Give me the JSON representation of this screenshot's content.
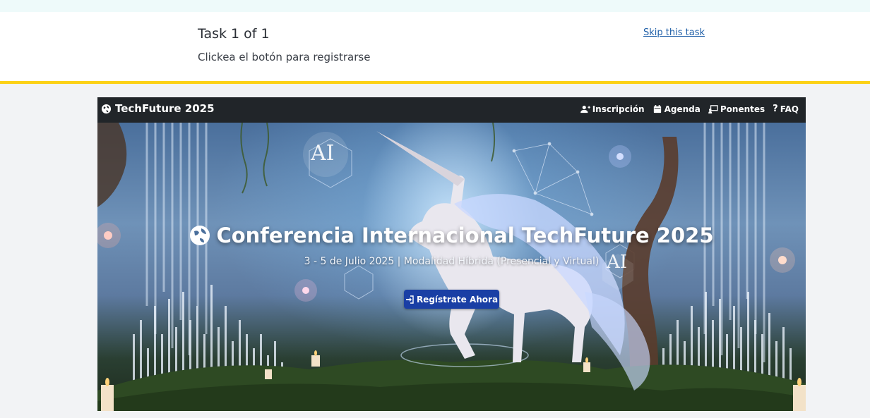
{
  "task": {
    "title": "Task 1 of 1",
    "instruction": "Clickea el botón para registrarse",
    "skip_label": "Skip this task"
  },
  "site": {
    "brand": "TechFuture 2025",
    "nav": [
      {
        "label": "Inscripción",
        "icon": "user-plus-icon"
      },
      {
        "label": "Agenda",
        "icon": "calendar-icon"
      },
      {
        "label": "Ponentes",
        "icon": "presenter-icon"
      },
      {
        "label": "FAQ",
        "icon": "question-icon"
      }
    ],
    "hero": {
      "title": "Conferencia Internacional TechFuture 2025",
      "subtitle": "3 - 5 de Julio 2025 | Modalidad Híbrida (Presencial y Virtual)",
      "cta_label": "Regístrate Ahora",
      "badge_left": "AI",
      "badge_right": "AI"
    }
  },
  "colors": {
    "accent_yellow": "#fcd116",
    "nav_bg": "#212529",
    "cta_bg": "#1a3fa5",
    "skip_link": "#1f5fa8"
  }
}
